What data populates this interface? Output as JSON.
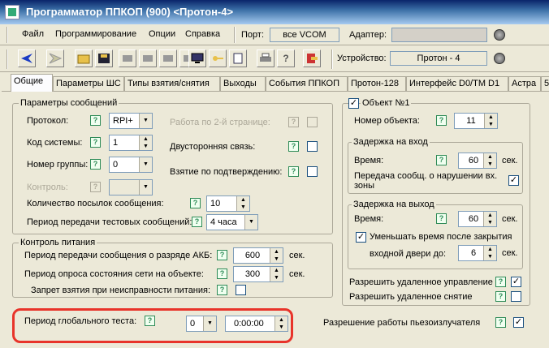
{
  "title": "Программатор ППКОП (900) <Протон-4>",
  "menu": [
    "Файл",
    "Программирование",
    "Опции",
    "Справка"
  ],
  "port": {
    "label": "Порт:",
    "value": "все VCOM"
  },
  "adapter": {
    "label": "Адаптер:",
    "value": ""
  },
  "device": {
    "label": "Устройство:",
    "value": "Протон - 4"
  },
  "tabs": [
    "Общие",
    "Параметры ШС",
    "Типы взятия/снятия",
    "Выходы",
    "События ППКОП",
    "Протон-128",
    "Интерфейс D0/TM D1",
    "Астра",
    "5"
  ],
  "msg_params": {
    "title": "Параметры сообщений",
    "protocol_label": "Протокол:",
    "protocol_value": "RPI+",
    "syscode_label": "Код системы:",
    "syscode_value": "1",
    "group_label": "Номер группы:",
    "group_value": "0",
    "control_label": "Контроль:",
    "control_value": "",
    "page2_label": "Работа по 2-й странице:",
    "twoway_label": "Двусторонняя связь:",
    "confirm_label": "Взятие по подтверждению:",
    "count_label": "Количество посылок сообщения:",
    "count_value": "10",
    "period_label": "Период передачи тестовых сообщений:",
    "period_value": "4 часа"
  },
  "power": {
    "title": "Контроль питания",
    "akb_label": "Период передачи сообщения о разряде АКБ:",
    "akb_value": "600",
    "net_label": "Период опроса состояния сети на объекте:",
    "net_value": "300",
    "ban_label": "Запрет взятия при неисправности питания:",
    "unit": "сек."
  },
  "global_test": {
    "label": "Период глобального теста:",
    "days_value": "0",
    "time_value": "0:00:00"
  },
  "piezo_label": "Разрешение работы пьезоизлучателя",
  "object": {
    "title": "Объект №1",
    "number_label": "Номер объекта:",
    "number_value": "11",
    "entry_title": "Задержка на вход",
    "entry_time_label": "Время:",
    "entry_time_value": "60",
    "unit": "сек.",
    "entry_violation_label_1": "Передача сообщ. о нарушении вх.",
    "entry_violation_label_2": "зоны",
    "exit_title": "Задержка на выход",
    "exit_time_label": "Время:",
    "exit_time_value": "60",
    "reduce_label_1": "Уменьшать время после закрытия",
    "reduce_label_2": "входной двери до:",
    "reduce_value": "6",
    "remote_control_label": "Разрешить удаленное управление",
    "remote_disarm_label": "Разрешить удаленное снятие"
  },
  "help_glyph": "?",
  "check_glyph": "✓"
}
